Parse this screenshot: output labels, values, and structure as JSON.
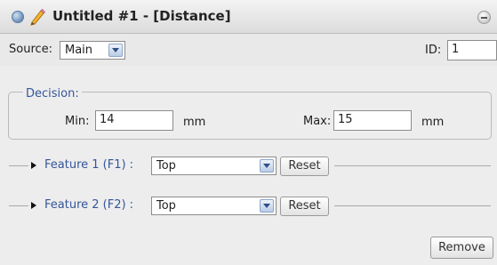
{
  "window": {
    "title": "Untitled #1 - [Distance]",
    "icons": [
      "blue-circle-icon",
      "pencil-icon",
      "close-icon"
    ]
  },
  "source": {
    "label": "Source:",
    "selected": "Main",
    "id_label": "ID:",
    "id_value": "1"
  },
  "decision": {
    "legend": "Decision:",
    "min_label": "Min:",
    "min_value": "14",
    "min_unit": "mm",
    "max_label": "Max:",
    "max_value": "15",
    "max_unit": "mm"
  },
  "features": [
    {
      "label": "Feature 1 (F1) :",
      "selected": "Top",
      "reset_label": "Reset"
    },
    {
      "label": "Feature 2 (F2) :",
      "selected": "Top",
      "reset_label": "Reset"
    }
  ],
  "actions": {
    "remove_label": "Remove"
  },
  "colors": {
    "accent_text": "#35569a",
    "titlebar": "#e4e4e4"
  }
}
